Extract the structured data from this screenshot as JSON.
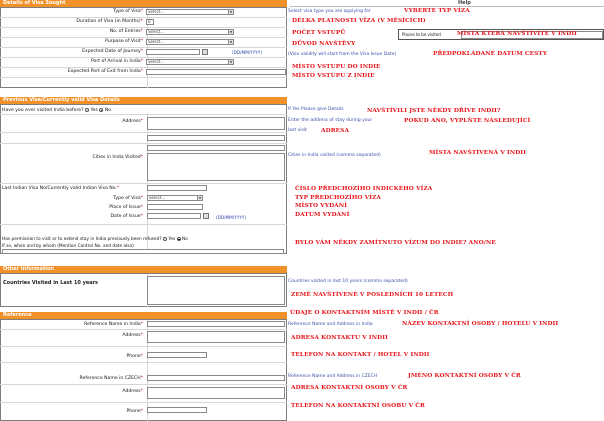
{
  "sections": {
    "visa_sought": "Details of Visa Sought",
    "previous_visa": "Previous Visa/Currently valid Visa Details",
    "other_info": "Other Information",
    "reference": "Reference"
  },
  "help_title": "Help",
  "visa_sought": {
    "type_label": "Type of Visa",
    "duration_label": "Duration of Visa (in Months)",
    "duration_value": "0",
    "entries_label": "No. of Entries",
    "purpose_label": "Purpose of Visit",
    "journey_label": "Expected Date of Journey",
    "port_arrival_label": "Port of Arrival in India",
    "port_exit_label": "Expected Port of Exit from India",
    "select_placeholder": "Select...",
    "date_format": "(DD/MM/YYYY)",
    "places_label": "Places to be visited"
  },
  "previous": {
    "question": "Have you ever visited India before?",
    "yes": "Yes",
    "no": "No",
    "address_label": "Address",
    "cities_label": "Cities in India Visited",
    "last_visa_label": "Last Indian Visa No/Currently valid Indian Visa No.",
    "type_label": "Type of Visa",
    "place_issue_label": "Place of Issue",
    "date_issue_label": "Date of Issue",
    "date_format": "(DD/MM/YYYY)",
    "refused_question": "Has permission to visit or to extend stay in India previously been refused?",
    "refused_detail": "If so, when and by whom (Mention Control No. and date also)"
  },
  "other": {
    "countries_label": "Countries Visited in Last 10 years"
  },
  "reference": {
    "india_name_label": "Reference Name in India",
    "india_address_label": "Address",
    "india_phone_label": "Phone",
    "czech_name_label": "Reference Name in CZECH",
    "czech_address_label": "Address",
    "czech_phone_label": "Phone"
  },
  "hints": {
    "visa_type": "Select visa type you are applying for",
    "visa_validity": "(Visa validity will start from the Visa Issue Date)",
    "places": "If Yes Please give Details",
    "address": "Enter the address of stay during your",
    "last_visit": "last visit",
    "cities": "Cities in India visited (comma separated)",
    "countries": "Countries visited in last 10 years (comma separated)",
    "ref_india": "Reference Name and Address in India",
    "ref_czech": "Reference Name and Address in CZECH"
  },
  "annotations": {
    "a1": "VYBERTE TYP VÍZA",
    "a2": "DÉLKA PLATNOSTI VÍZA (V MĚSÍCÍCH)",
    "a3": "POČET VSTUPŮ",
    "a4": "MÍSTA KTERÁ NAVŠTÍVÍTE V INDII",
    "a5": "DŮVOD NÁVŠTĚVY",
    "a6": "PŘEDPOKLÁDANÉ DATUM CESTY",
    "a7": "MÍSTO VSTUPU DO INDIE",
    "a8": "MÍSTO VSTUPU Z INDIE",
    "a9": "NAVŠTÍVILI JSTE NĚKDY DŘÍVE INDII?",
    "a10": "POKUD ANO, VYPLŇTE NÁSLEDUJÍCÍ",
    "a11": "ADRESA",
    "a12": "MÍSTA NAVŠTÍVENÁ V INDII",
    "a13": "ČÍSLO PŘEDCHOZÍHO INDICKÉHO VÍZA",
    "a14": "TYP PŘEDCHOZÍHO VÍZA",
    "a15": "MÍSTO VYDÁNÍ",
    "a16": "DATUM VYDÁNÍ",
    "a17": "BYLO VÁM NĚKDY ZAMÍTNUTO VÍZUM DO INDIE? ANO/NE",
    "a18": "ZEMĚ NAVŠTÍVENÉ V POSLEDNÍCH 10 LETECH",
    "a19": "ÚDAJE O KONTAKTNÍM MÍSTĚ V INDII / ČR",
    "a20": "NÁZEV KONTAKTNÍ OSOBY / HOTELU V INDII",
    "a21": "ADRESA KONTAKTU V INDII",
    "a22": "TELEFON NA KONTAKT / HOTEL V INDII",
    "a23": "JMÉNO KONTAKTNÍ OSOBY V ČR",
    "a24": "ADRESA KONTAKTNÍ OSOBY V ČR",
    "a25": "TELEFON NA KONTAKTNÍ OSOBU V ČR"
  }
}
